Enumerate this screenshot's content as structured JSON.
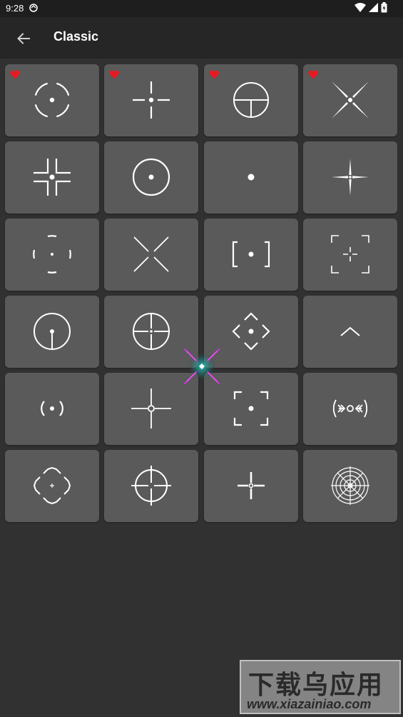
{
  "status_bar": {
    "time": "9:28"
  },
  "app_bar": {
    "title": "Classic",
    "back_icon": "arrow-back-icon"
  },
  "colors": {
    "card": "#5a5a5a",
    "background": "#313131",
    "favorite": "#e41b23",
    "crosshair": "#ffffff"
  },
  "crosshairs": [
    {
      "icon": "split-circle-dot-crosshair-icon",
      "favorite": true
    },
    {
      "icon": "cross-dot-crosshair-icon",
      "favorite": true
    },
    {
      "icon": "circle-t-crosshair-icon",
      "favorite": true
    },
    {
      "icon": "x-dot-crosshair-icon",
      "favorite": true
    },
    {
      "icon": "corner-brackets-dot-crosshair-icon",
      "favorite": false
    },
    {
      "icon": "circle-dot-crosshair-icon",
      "favorite": false
    },
    {
      "icon": "dot-crosshair-icon",
      "favorite": false
    },
    {
      "icon": "star-cross-crosshair-icon",
      "favorite": false
    },
    {
      "icon": "dashed-circle-dot-crosshair-icon",
      "favorite": false
    },
    {
      "icon": "x-lines-crosshair-icon",
      "favorite": false
    },
    {
      "icon": "square-brackets-dot-crosshair-icon",
      "favorite": false
    },
    {
      "icon": "frame-cross-crosshair-icon",
      "favorite": false
    },
    {
      "icon": "circle-post-crosshair-icon",
      "favorite": false
    },
    {
      "icon": "circle-cross-crosshair-icon",
      "favorite": false
    },
    {
      "icon": "diamond-chevrons-dot-crosshair-icon",
      "favorite": false
    },
    {
      "icon": "chevron-up-crosshair-icon",
      "favorite": false
    },
    {
      "icon": "parentheses-dot-crosshair-icon",
      "favorite": false
    },
    {
      "icon": "cross-ring-crosshair-icon",
      "favorite": false
    },
    {
      "icon": "corner-frame-dot-crosshair-icon",
      "favorite": false
    },
    {
      "icon": "arrows-ring-crosshair-icon",
      "favorite": false
    },
    {
      "icon": "octagon-plus-crosshair-icon",
      "favorite": false
    },
    {
      "icon": "circle-gap-crosshair-icon",
      "favorite": false
    },
    {
      "icon": "thick-cross-ring-crosshair-icon",
      "favorite": false
    },
    {
      "icon": "radar-crosshair-icon",
      "favorite": false
    }
  ],
  "floating_crosshair": {
    "icon": "active-crosshair-overlay-icon"
  },
  "watermark": {
    "title": "下载乌应用",
    "url": "www.xiazainiao.com"
  }
}
